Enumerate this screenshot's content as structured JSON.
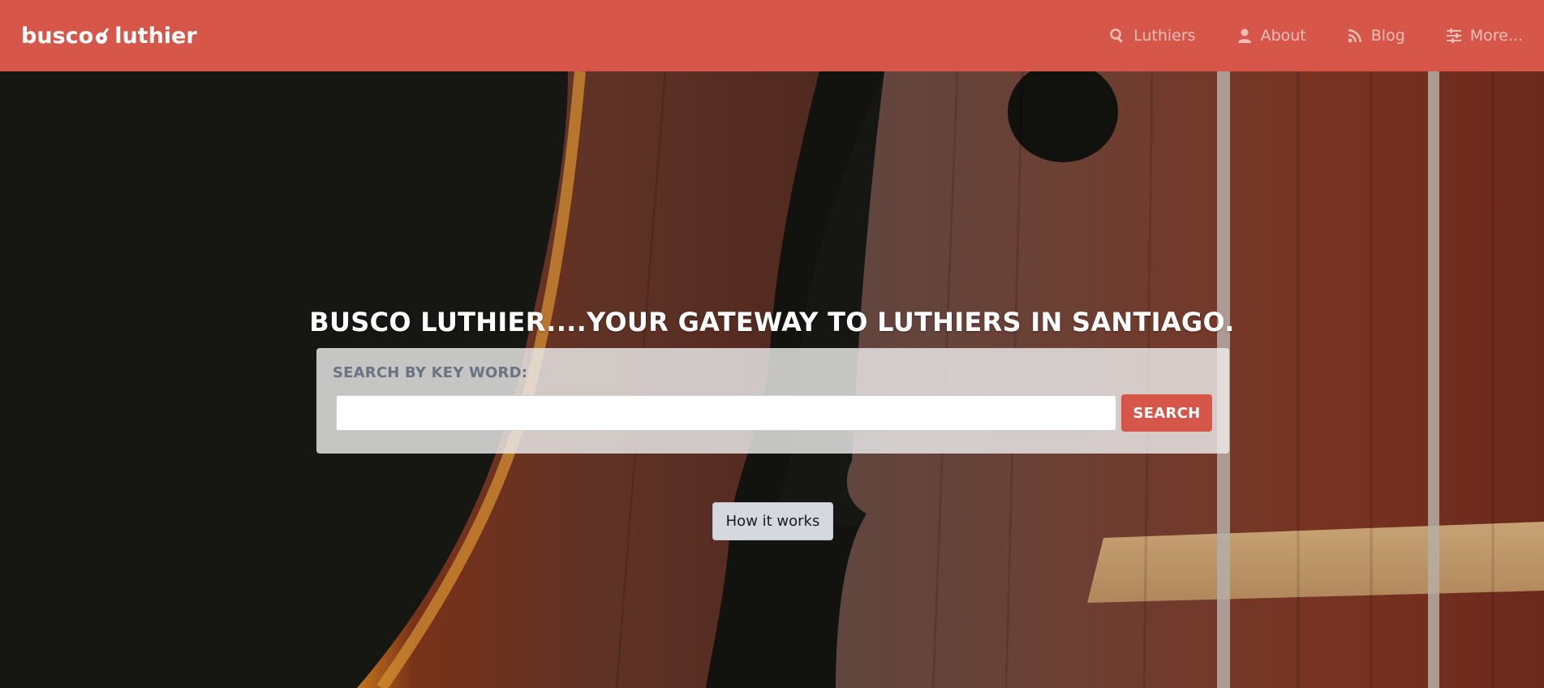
{
  "brand": {
    "left": "busco",
    "right": "luthier"
  },
  "nav": {
    "items": [
      {
        "label": "Luthiers",
        "icon": "search-icon"
      },
      {
        "label": "About",
        "icon": "user-icon"
      },
      {
        "label": "Blog",
        "icon": "rss-icon"
      },
      {
        "label": "More...",
        "icon": "sliders-icon"
      }
    ]
  },
  "hero": {
    "headline": "BUSCO LUTHIER....YOUR GATEWAY TO LUTHIERS IN SANTIAGO.",
    "background": "violin-closeup-photo"
  },
  "search": {
    "label": "SEARCH BY KEY WORD:",
    "value": "",
    "placeholder": "",
    "button_label": "SEARCH"
  },
  "how_it_works": {
    "label": "How it works"
  },
  "colors": {
    "brand": "#d6574a",
    "nav_text": "#f0c0b8",
    "label_text": "#6a7480",
    "secondary_button": "#d6d8e0"
  }
}
